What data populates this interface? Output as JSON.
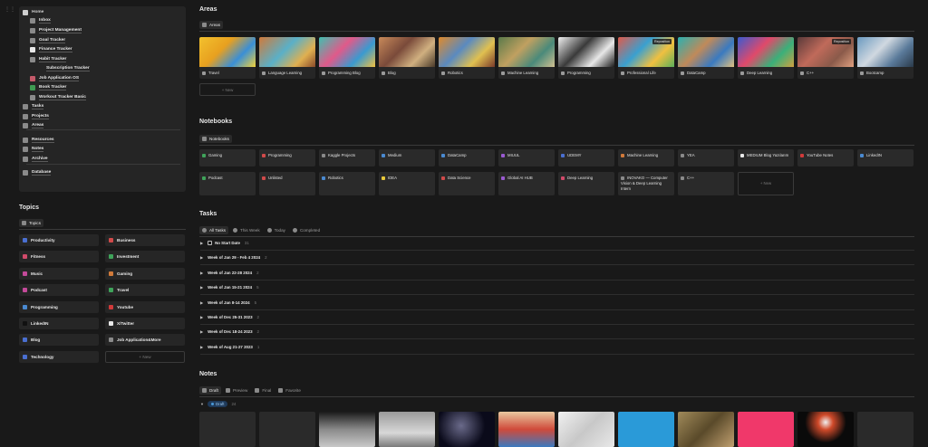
{
  "sidebar": {
    "home": "Home",
    "items": [
      {
        "label": "Inbox",
        "color": "#8a8a8a"
      },
      {
        "label": "Project Management",
        "color": "#8a8a8a"
      },
      {
        "label": "Goal Tracker",
        "color": "#8a8a8a"
      },
      {
        "label": "Finance Tracker",
        "color": "#e8e8e8"
      },
      {
        "label": "Habit Tracker",
        "color": "#8a8a8a"
      },
      {
        "label": "Subscription Tracker",
        "color": "transparent"
      },
      {
        "label": "Job Application OS",
        "color": "#c45a6a"
      },
      {
        "label": "Book Tracker",
        "color": "#3f9a52"
      },
      {
        "label": "Workout Tracker Basic",
        "color": "#8a8a8a"
      },
      {
        "label": "Tasks",
        "color": "#8a8a8a"
      },
      {
        "label": "Projects",
        "color": "#8a8a8a"
      },
      {
        "label": "Areas",
        "color": "#8a8a8a"
      },
      {
        "label": "Resources",
        "color": "#8a8a8a"
      },
      {
        "label": "Notes",
        "color": "#8a8a8a"
      },
      {
        "label": "Archive",
        "color": "#8a8a8a"
      },
      {
        "label": "Database",
        "color": "#8a8a8a"
      }
    ]
  },
  "topics": {
    "title": "Topics",
    "tab": "Topics",
    "items": [
      {
        "label": "Productivity",
        "color": "#4a6fd1"
      },
      {
        "label": "Business",
        "color": "#d14a4a"
      },
      {
        "label": "Fitness",
        "color": "#d14a6a"
      },
      {
        "label": "Investment",
        "color": "#3fa35a"
      },
      {
        "label": "Music",
        "color": "#c44a9a"
      },
      {
        "label": "Gaming",
        "color": "#d17a3a"
      },
      {
        "label": "Podcast",
        "color": "#c44a9a"
      },
      {
        "label": "Travel",
        "color": "#3fa35a"
      },
      {
        "label": "Programming",
        "color": "#4a8ad1"
      },
      {
        "label": "Youtube",
        "color": "#d13a3a"
      },
      {
        "label": "LinkedIN",
        "color": "#111111"
      },
      {
        "label": "X/Twitter",
        "color": "#e8e8e8"
      },
      {
        "label": "Blog",
        "color": "#4a6fd1"
      },
      {
        "label": "Job Application&More",
        "color": "#8a8a8a"
      },
      {
        "label": "Technology",
        "color": "#4a6fd1"
      }
    ],
    "new_label": "+ New"
  },
  "areas": {
    "title": "Areas",
    "tab": "Areas",
    "reposition": "Reposition",
    "cards": [
      {
        "label": "Travel",
        "img": "linear-gradient(135deg,#f2c12e,#e8a01f 40%,#3a8fd6 70%,#f0d23a)"
      },
      {
        "label": "Language Learning",
        "img": "linear-gradient(135deg,#d07a3a,#5ab0c8 45%,#e0b050 75%,#8a4a2a)"
      },
      {
        "label": "Programming Blog",
        "img": "linear-gradient(135deg,#3fc0b0,#e05a8a 40%,#3a9ad0 70%,#f0c040)"
      },
      {
        "label": "Blog",
        "img": "linear-gradient(135deg,#c88a5a,#7a4a3a 40%,#d0b080 70%,#4a3a2a)"
      },
      {
        "label": "Robotics",
        "img": "linear-gradient(135deg,#e08a2a,#5a8ac0 40%,#e0c050 70%,#7a3a2a)"
      },
      {
        "label": "Machine Learning",
        "img": "linear-gradient(135deg,#5a7a4a,#c0a060 40%,#4a8a7a 70%,#d0c090)"
      },
      {
        "label": "Programming",
        "img": "linear-gradient(135deg,#f0f0f0,#3a3a3a 40%,#e8e8e8 70%,#1a1a1a)"
      },
      {
        "label": "Professional Life",
        "img": "linear-gradient(135deg,#e05a4a,#3aa0d0 40%,#f0c040 70%,#5ab05a)"
      },
      {
        "label": "DataCamp",
        "img": "linear-gradient(135deg,#2ab0b0,#c08a5a 40%,#3a7ac0 70%,#e0c080)"
      },
      {
        "label": "Deep Learning",
        "img": "linear-gradient(135deg,#3a5ad0,#e04a6a 40%,#3ab07a 70%,#d0a040)"
      },
      {
        "label": "C++",
        "img": "linear-gradient(135deg,#5a3a3a,#c06a5a 40%,#8a5a4a 70%,#e0a080)"
      },
      {
        "label": "Bootcamp",
        "img": "linear-gradient(135deg,#6a9ac0,#d0d8e0 40%,#5a7a9a 70%,#2a3a4a)"
      }
    ],
    "new_label": "+ New"
  },
  "notebooks": {
    "title": "Notebooks",
    "tab": "Notebooks",
    "row1": [
      {
        "label": "Gaming",
        "color": "#3fa35a"
      },
      {
        "label": "Programming",
        "color": "#d14a4a"
      },
      {
        "label": "Kaggle Projects",
        "color": "#8a8a8a"
      },
      {
        "label": "Medium",
        "color": "#4a8ad1"
      },
      {
        "label": "DataCamp",
        "color": "#4a8ad1"
      },
      {
        "label": "MIUUL",
        "color": "#9a5ad1"
      },
      {
        "label": "UDEMY",
        "color": "#4a6fd1"
      },
      {
        "label": "Machine Learning",
        "color": "#d17a3a"
      },
      {
        "label": "YEA",
        "color": "#8a8a8a"
      },
      {
        "label": "MEDIUM Blog Yazılarım",
        "color": "#e8e8e8"
      },
      {
        "label": "YouTube Notes",
        "color": "#d13a3a"
      },
      {
        "label": "LinkedIN",
        "color": "#4a8ad1"
      }
    ],
    "row2": [
      {
        "label": "Podcast",
        "color": "#3fa35a"
      },
      {
        "label": "Unlisted",
        "color": "#d14a4a"
      },
      {
        "label": "Robotics",
        "color": "#4a8ad1"
      },
      {
        "label": "IDEA",
        "color": "#e8c83a"
      },
      {
        "label": "Data Science",
        "color": "#d14a4a"
      },
      {
        "label": "Global AI HUB",
        "color": "#9a5ad1"
      },
      {
        "label": "Deep Learning",
        "color": "#d14a6a"
      },
      {
        "label": "INOVAKO — Computer Vision & Deep Learning Intern",
        "color": "#8a8a8a"
      },
      {
        "label": "C++",
        "color": "#8a8a8a"
      }
    ],
    "new_label": "+ New"
  },
  "tasks": {
    "title": "Tasks",
    "tabs": [
      "All Tasks",
      "This Week",
      "Today",
      "Completed"
    ],
    "groups": [
      {
        "label": "No Start Date",
        "count": "31"
      },
      {
        "label": "Week of Jan 29 - Feb 4 2024",
        "count": "2"
      },
      {
        "label": "Week of Jan 22-28 2024",
        "count": "2"
      },
      {
        "label": "Week of Jan 15-21 2024",
        "count": "5"
      },
      {
        "label": "Week of Jan 8-14 2024",
        "count": "5"
      },
      {
        "label": "Week of Dec 25-31 2023",
        "count": "2"
      },
      {
        "label": "Week of Dec 18-24 2023",
        "count": "2"
      },
      {
        "label": "Week of Aug 21-27 2023",
        "count": "1"
      }
    ]
  },
  "notes": {
    "title": "Notes",
    "tabs": [
      "Draft",
      "Preview",
      "Final",
      "Favorite"
    ],
    "group": "Draft",
    "group_count": "24",
    "cards": [
      "#2a2a2a",
      "#2a2a2a",
      "linear-gradient(180deg,#1a1a1a,#8a8a8a 50%,#c8c8c8)",
      "linear-gradient(180deg,#9a9a9a,#d8d8d8 60%,#7a7a7a)",
      "radial-gradient(circle at 40% 40%,#6a6a8a,#0a0a1a 60%)",
      "linear-gradient(180deg,#e8c8a0,#d04a3a 50%,#3a7ac0)",
      "linear-gradient(135deg,#f0f0f0,#c8c8c8 50%,#e8e8e8)",
      "#2a9ad8",
      "linear-gradient(135deg,#a08a5a,#5a4a2a 50%,#c0a070)",
      "#f0386a",
      "radial-gradient(circle at 50% 30%,#f0f0f0,#d04a2a 20%,#0a0a0a 55%)",
      "#2a2a2a"
    ]
  }
}
